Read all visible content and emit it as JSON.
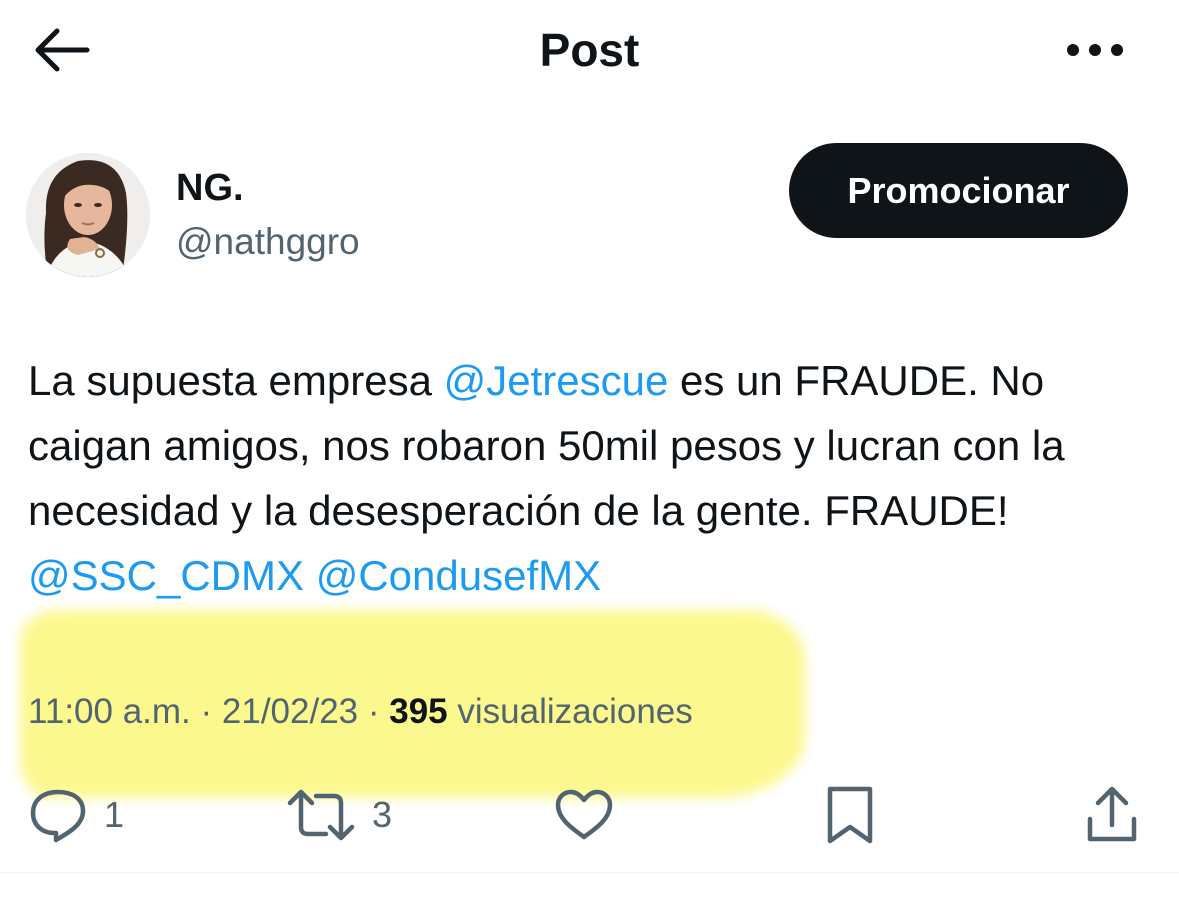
{
  "header": {
    "title": "Post",
    "back_icon": "arrow-left-icon",
    "more_icon": "more-horizontal-icon"
  },
  "author": {
    "name": "NG.",
    "handle": "@nathggro",
    "promote_label": "Promocionar"
  },
  "tweet": {
    "text_1": "La supuesta empresa ",
    "mention_1": "@Jetrescue",
    "text_2": " es un FRAUDE. No caigan amigos, nos robaron 50mil pesos y lucran con la necesidad y la desesperación de la gente. FRAUDE! ",
    "mention_2": "@SSC_CDMX",
    "mention_3": "@CondusefMX",
    "time": "11:00 a.m.",
    "sep": " · ",
    "date": "21/02/23",
    "views_count": "395",
    "views_label": " visualizaciones"
  },
  "actions": {
    "replies": "1",
    "retweets": "3"
  },
  "colors": {
    "accent": "#1d9bf0",
    "text": "#0f1419",
    "muted": "#536471",
    "highlight": "#fbf77a"
  }
}
